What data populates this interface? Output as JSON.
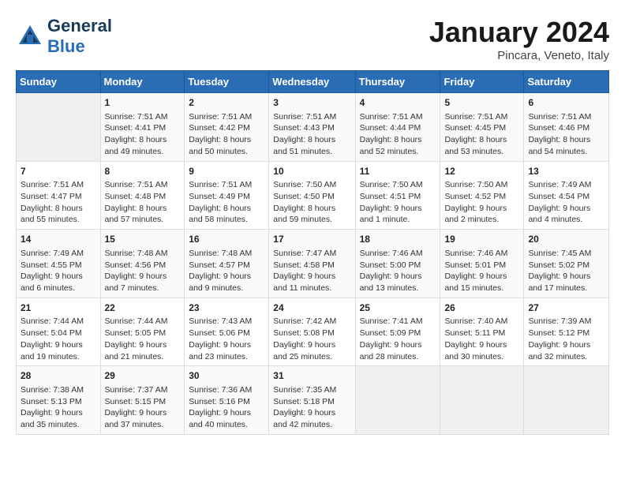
{
  "header": {
    "logo_general": "General",
    "logo_blue": "Blue",
    "month_title": "January 2024",
    "subtitle": "Pincara, Veneto, Italy"
  },
  "days_of_week": [
    "Sunday",
    "Monday",
    "Tuesday",
    "Wednesday",
    "Thursday",
    "Friday",
    "Saturday"
  ],
  "weeks": [
    [
      {
        "num": "",
        "info": ""
      },
      {
        "num": "1",
        "info": "Sunrise: 7:51 AM\nSunset: 4:41 PM\nDaylight: 8 hours\nand 49 minutes."
      },
      {
        "num": "2",
        "info": "Sunrise: 7:51 AM\nSunset: 4:42 PM\nDaylight: 8 hours\nand 50 minutes."
      },
      {
        "num": "3",
        "info": "Sunrise: 7:51 AM\nSunset: 4:43 PM\nDaylight: 8 hours\nand 51 minutes."
      },
      {
        "num": "4",
        "info": "Sunrise: 7:51 AM\nSunset: 4:44 PM\nDaylight: 8 hours\nand 52 minutes."
      },
      {
        "num": "5",
        "info": "Sunrise: 7:51 AM\nSunset: 4:45 PM\nDaylight: 8 hours\nand 53 minutes."
      },
      {
        "num": "6",
        "info": "Sunrise: 7:51 AM\nSunset: 4:46 PM\nDaylight: 8 hours\nand 54 minutes."
      }
    ],
    [
      {
        "num": "7",
        "info": "Sunrise: 7:51 AM\nSunset: 4:47 PM\nDaylight: 8 hours\nand 55 minutes."
      },
      {
        "num": "8",
        "info": "Sunrise: 7:51 AM\nSunset: 4:48 PM\nDaylight: 8 hours\nand 57 minutes."
      },
      {
        "num": "9",
        "info": "Sunrise: 7:51 AM\nSunset: 4:49 PM\nDaylight: 8 hours\nand 58 minutes."
      },
      {
        "num": "10",
        "info": "Sunrise: 7:50 AM\nSunset: 4:50 PM\nDaylight: 8 hours\nand 59 minutes."
      },
      {
        "num": "11",
        "info": "Sunrise: 7:50 AM\nSunset: 4:51 PM\nDaylight: 9 hours\nand 1 minute."
      },
      {
        "num": "12",
        "info": "Sunrise: 7:50 AM\nSunset: 4:52 PM\nDaylight: 9 hours\nand 2 minutes."
      },
      {
        "num": "13",
        "info": "Sunrise: 7:49 AM\nSunset: 4:54 PM\nDaylight: 9 hours\nand 4 minutes."
      }
    ],
    [
      {
        "num": "14",
        "info": "Sunrise: 7:49 AM\nSunset: 4:55 PM\nDaylight: 9 hours\nand 6 minutes."
      },
      {
        "num": "15",
        "info": "Sunrise: 7:48 AM\nSunset: 4:56 PM\nDaylight: 9 hours\nand 7 minutes."
      },
      {
        "num": "16",
        "info": "Sunrise: 7:48 AM\nSunset: 4:57 PM\nDaylight: 9 hours\nand 9 minutes."
      },
      {
        "num": "17",
        "info": "Sunrise: 7:47 AM\nSunset: 4:58 PM\nDaylight: 9 hours\nand 11 minutes."
      },
      {
        "num": "18",
        "info": "Sunrise: 7:46 AM\nSunset: 5:00 PM\nDaylight: 9 hours\nand 13 minutes."
      },
      {
        "num": "19",
        "info": "Sunrise: 7:46 AM\nSunset: 5:01 PM\nDaylight: 9 hours\nand 15 minutes."
      },
      {
        "num": "20",
        "info": "Sunrise: 7:45 AM\nSunset: 5:02 PM\nDaylight: 9 hours\nand 17 minutes."
      }
    ],
    [
      {
        "num": "21",
        "info": "Sunrise: 7:44 AM\nSunset: 5:04 PM\nDaylight: 9 hours\nand 19 minutes."
      },
      {
        "num": "22",
        "info": "Sunrise: 7:44 AM\nSunset: 5:05 PM\nDaylight: 9 hours\nand 21 minutes."
      },
      {
        "num": "23",
        "info": "Sunrise: 7:43 AM\nSunset: 5:06 PM\nDaylight: 9 hours\nand 23 minutes."
      },
      {
        "num": "24",
        "info": "Sunrise: 7:42 AM\nSunset: 5:08 PM\nDaylight: 9 hours\nand 25 minutes."
      },
      {
        "num": "25",
        "info": "Sunrise: 7:41 AM\nSunset: 5:09 PM\nDaylight: 9 hours\nand 28 minutes."
      },
      {
        "num": "26",
        "info": "Sunrise: 7:40 AM\nSunset: 5:11 PM\nDaylight: 9 hours\nand 30 minutes."
      },
      {
        "num": "27",
        "info": "Sunrise: 7:39 AM\nSunset: 5:12 PM\nDaylight: 9 hours\nand 32 minutes."
      }
    ],
    [
      {
        "num": "28",
        "info": "Sunrise: 7:38 AM\nSunset: 5:13 PM\nDaylight: 9 hours\nand 35 minutes."
      },
      {
        "num": "29",
        "info": "Sunrise: 7:37 AM\nSunset: 5:15 PM\nDaylight: 9 hours\nand 37 minutes."
      },
      {
        "num": "30",
        "info": "Sunrise: 7:36 AM\nSunset: 5:16 PM\nDaylight: 9 hours\nand 40 minutes."
      },
      {
        "num": "31",
        "info": "Sunrise: 7:35 AM\nSunset: 5:18 PM\nDaylight: 9 hours\nand 42 minutes."
      },
      {
        "num": "",
        "info": ""
      },
      {
        "num": "",
        "info": ""
      },
      {
        "num": "",
        "info": ""
      }
    ]
  ]
}
